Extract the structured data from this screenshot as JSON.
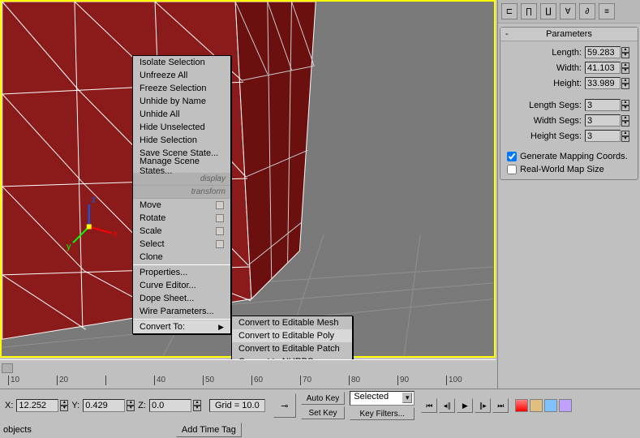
{
  "viewport": {
    "object_color": "#8b1a1a",
    "edge_color": "#ffffff",
    "bg_color": "#7a7a7a",
    "border_color": "#ffff00"
  },
  "context_menu": {
    "group1": [
      "Isolate Selection",
      "Unfreeze All",
      "Freeze Selection",
      "Unhide by Name",
      "Unhide All",
      "Hide Unselected",
      "Hide Selection",
      "Save Scene State...",
      "Manage Scene States..."
    ],
    "display_label": "display",
    "transform_label": "transform",
    "transform_items": [
      "Move",
      "Rotate",
      "Scale",
      "Select",
      "Clone"
    ],
    "group3": [
      "Properties...",
      "Curve Editor...",
      "Dope Sheet...",
      "Wire Parameters..."
    ],
    "convert_label": "Convert To:",
    "submenu": {
      "items": [
        "Convert to Editable Mesh",
        "Convert to Editable Poly",
        "Convert to Editable Patch",
        "Convert to NURBS"
      ],
      "highlighted_index": 1
    }
  },
  "parameters": {
    "title": "Parameters",
    "length_label": "Length:",
    "length_value": "59.283",
    "width_label": "Width:",
    "width_value": "41.103",
    "height_label": "Height:",
    "height_value": "33.989",
    "length_segs_label": "Length Segs:",
    "length_segs_value": "3",
    "width_segs_label": "Width Segs:",
    "width_segs_value": "3",
    "height_segs_label": "Height Segs:",
    "height_segs_value": "3",
    "gen_mapping_label": "Generate Mapping Coords.",
    "gen_mapping_checked": true,
    "real_world_label": "Real-World Map Size",
    "real_world_checked": false
  },
  "timeline": {
    "ticks": [
      "10",
      "20",
      "",
      "40",
      "50",
      "60",
      "70",
      "80",
      "90",
      "100"
    ]
  },
  "status": {
    "x_label": "X:",
    "x_value": "12.252",
    "y_label": "Y:",
    "y_value": "0.429",
    "z_label": "Z:",
    "z_value": "0.0",
    "grid_label": "Grid = 10.0",
    "objects_label": "objects",
    "add_time_tag": "Add Time Tag",
    "auto_key": "Auto Key",
    "set_key": "Set Key",
    "selected": "Selected",
    "key_filters": "Key Filters..."
  }
}
